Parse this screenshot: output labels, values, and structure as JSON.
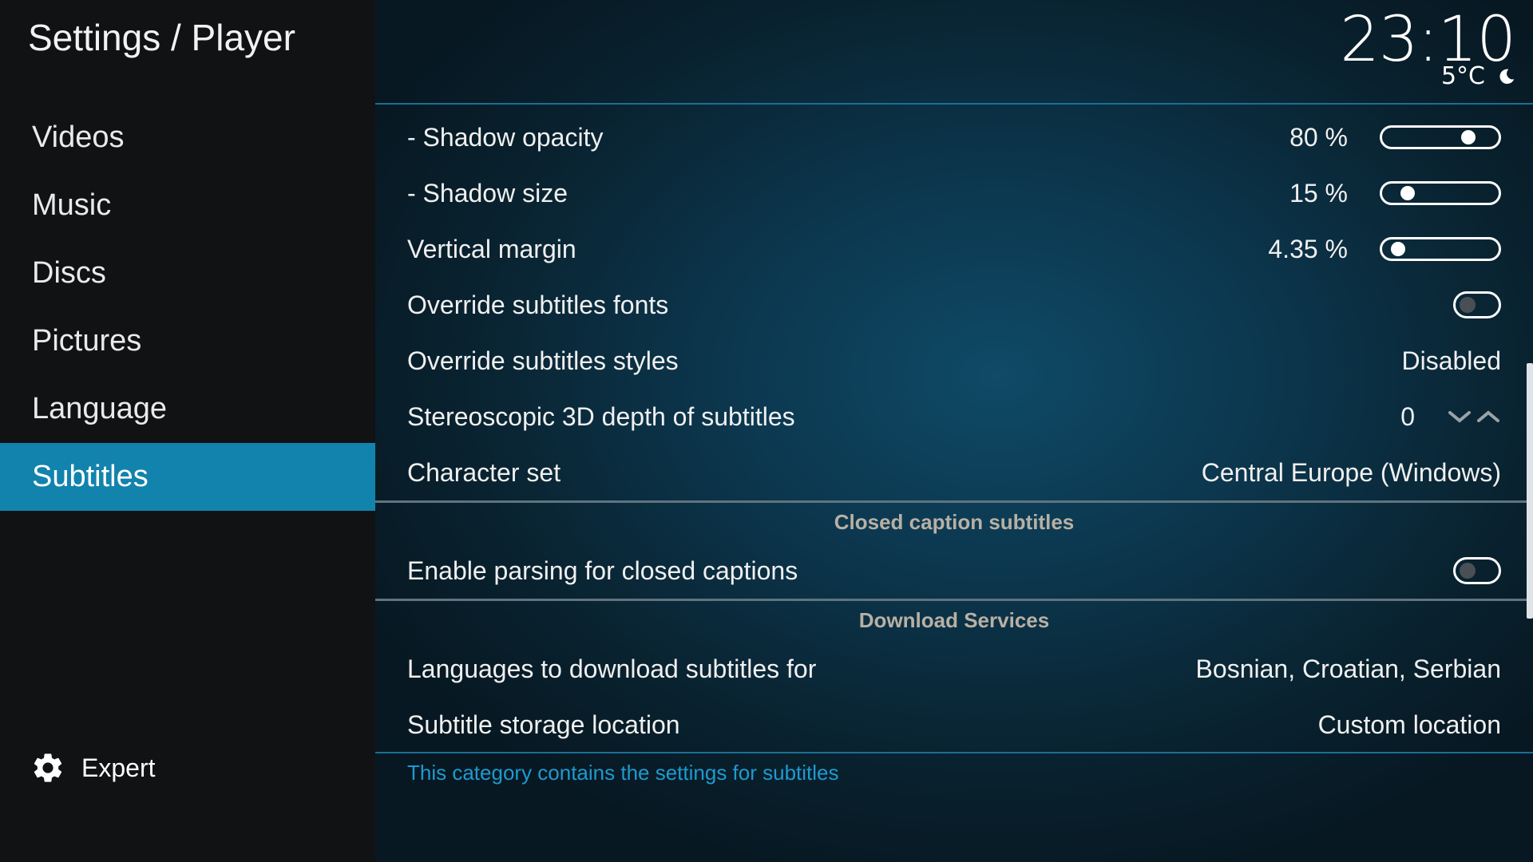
{
  "header": {
    "title": "Settings / Player",
    "clock": "23:10",
    "temperature": "5°C",
    "weather_icon": "moon-icon"
  },
  "sidebar": {
    "items": [
      {
        "label": "Videos"
      },
      {
        "label": "Music"
      },
      {
        "label": "Discs"
      },
      {
        "label": "Pictures"
      },
      {
        "label": "Language"
      },
      {
        "label": "Subtitles",
        "active": true
      }
    ],
    "expert": {
      "label": "Expert",
      "icon": "gear-icon"
    }
  },
  "settings": {
    "shadow_opacity": {
      "label": "- Shadow opacity",
      "value": "80 %",
      "level": 0.8
    },
    "shadow_size": {
      "label": "- Shadow size",
      "value": "15 %",
      "level": 0.15
    },
    "vertical_margin": {
      "label": "Vertical margin",
      "value": "4.35 %",
      "level": 0.0435
    },
    "override_fonts": {
      "label": "Override subtitles fonts",
      "enabled": false
    },
    "override_styles": {
      "label": "Override subtitles styles",
      "value": "Disabled"
    },
    "stereo_depth": {
      "label": "Stereoscopic 3D depth of subtitles",
      "value": "0"
    },
    "character_set": {
      "label": "Character set",
      "value": "Central Europe (Windows)"
    },
    "closed_caption_section": "Closed caption subtitles",
    "enable_cc": {
      "label": "Enable parsing for closed captions",
      "enabled": false
    },
    "download_section": "Download Services",
    "languages": {
      "label": "Languages to download subtitles for",
      "value": "Bosnian, Croatian, Serbian"
    },
    "storage": {
      "label": "Subtitle storage location",
      "value": "Custom location"
    }
  },
  "footer": {
    "description": "This category contains the settings for subtitles"
  },
  "colors": {
    "accent": "#1283ad",
    "description_text": "#1f9ad0",
    "section_title": "#b8b0a4"
  }
}
